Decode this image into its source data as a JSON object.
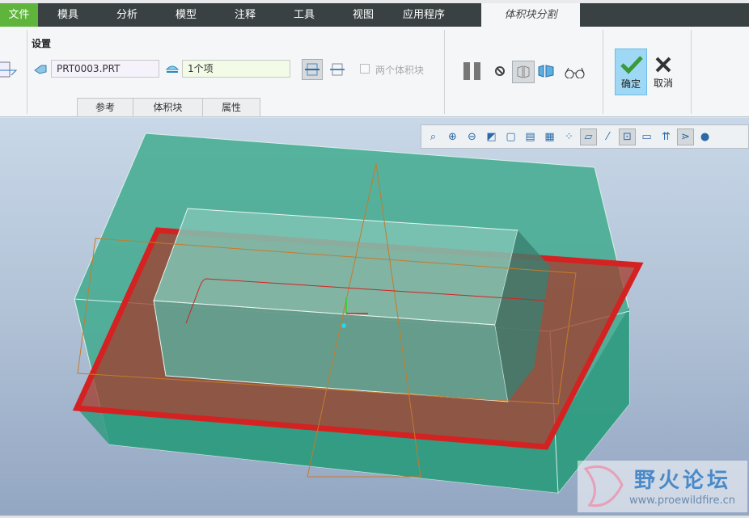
{
  "menu": {
    "tabs": [
      "文件",
      "模具",
      "分析",
      "模型",
      "注释",
      "工具",
      "视图",
      "应用程序"
    ],
    "active_tab": "体积块分割"
  },
  "ribbon": {
    "group_label": "设置",
    "part_field": "PRT0003.PRT",
    "surface_field": "1个项",
    "two_volumes_label": "两个体积块",
    "two_volumes_checked": false,
    "subtabs": [
      "参考",
      "体积块",
      "属性"
    ],
    "ok_label": "确定",
    "cancel_label": "取消"
  },
  "view_toolbar": {
    "icons": [
      "refit",
      "zoom-in",
      "zoom-out",
      "repaint",
      "view-orientation",
      "saved-views",
      "display-style",
      "datum-display",
      "plane-display",
      "axis-display",
      "point-display",
      "spin-center",
      "annotation-display",
      "sketch",
      "more"
    ]
  },
  "watermark": {
    "title": "野火论坛",
    "url": "www.proewildfire.cn"
  },
  "colors": {
    "file_tab": "#5fb53c",
    "menubar": "#3a4143",
    "ok_bg": "#9fd8f5",
    "parting": "#d42222",
    "mold_body": "#3aa98a"
  }
}
